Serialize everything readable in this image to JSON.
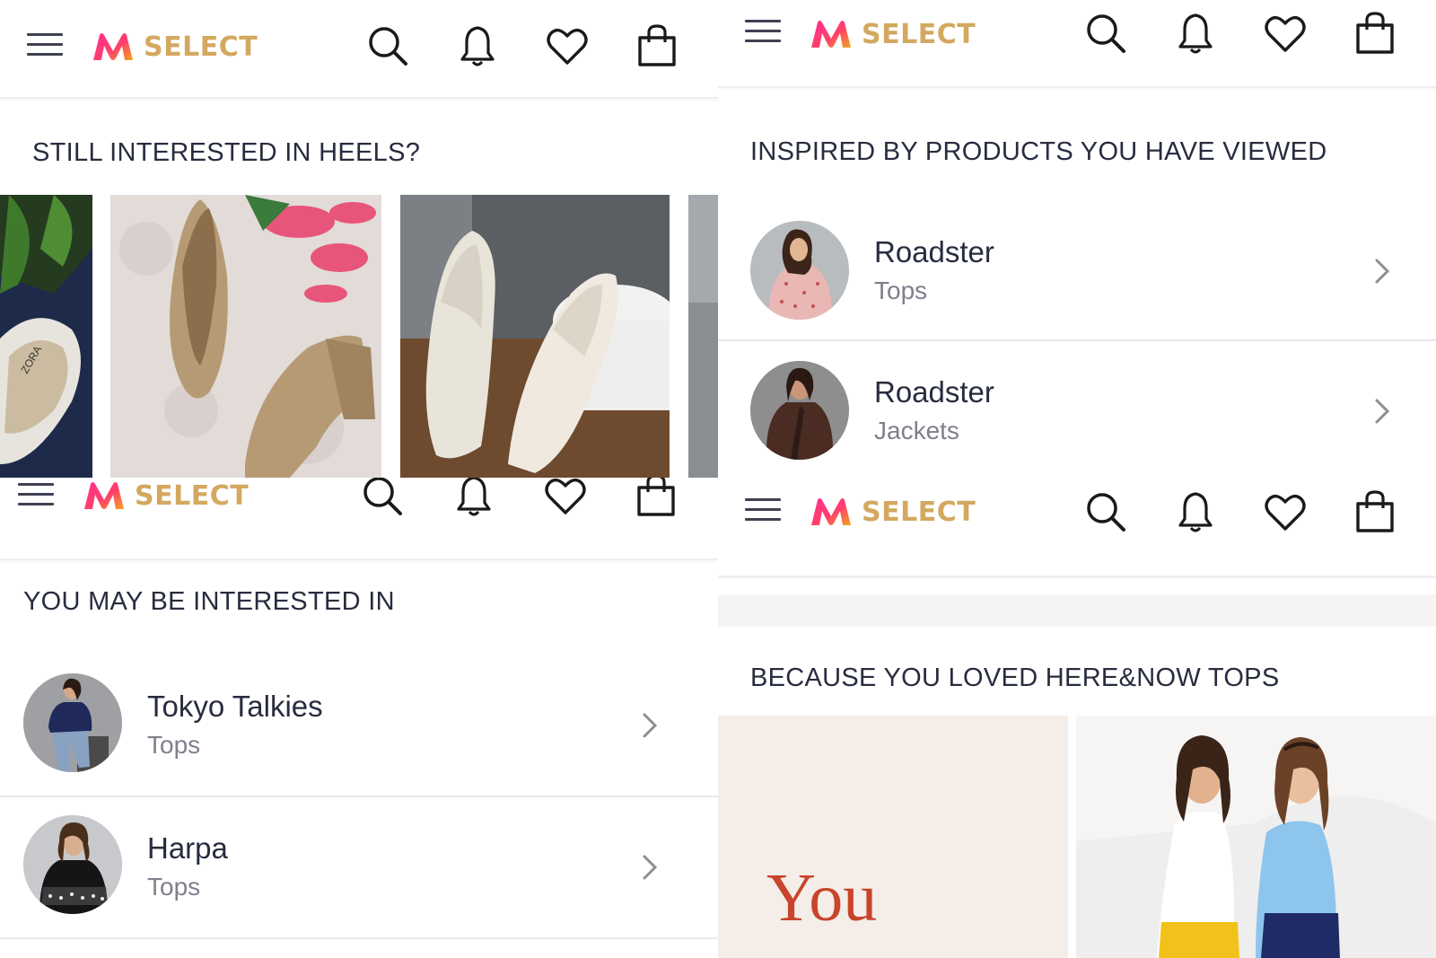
{
  "app": {
    "brand_text": "SELECT",
    "brand_colors": {
      "gold": "#d3a85f",
      "accent_pink": "#ff3f6c",
      "accent_orange": "#f68b1e"
    },
    "icons": [
      "menu-icon",
      "myntra-logo-icon",
      "search-icon",
      "bell-icon",
      "heart-icon",
      "bag-icon",
      "chevron-right-icon"
    ]
  },
  "top_left": {
    "section_title": "STILL INTERESTED IN HEELS?",
    "products": [
      {
        "name": "white-flat-shoe-partial",
        "print": "ZORA"
      },
      {
        "name": "gold-croc-block-heels"
      },
      {
        "name": "white-wedge-pumps"
      },
      {
        "name": "gray-shoe-partial"
      }
    ]
  },
  "top_right": {
    "section_title": "INSPIRED BY PRODUCTS YOU HAVE VIEWED",
    "items": [
      {
        "brand": "Roadster",
        "category": "Tops"
      },
      {
        "brand": "Roadster",
        "category": "Jackets"
      }
    ]
  },
  "bottom_left": {
    "section_title": "YOU MAY BE INTERESTED IN",
    "items": [
      {
        "brand": "Tokyo Talkies",
        "category": "Tops"
      },
      {
        "brand": "Harpa",
        "category": "Tops"
      }
    ]
  },
  "bottom_right": {
    "section_title": "BECAUSE YOU LOVED HERE&NOW TOPS",
    "banner_text": "You"
  }
}
